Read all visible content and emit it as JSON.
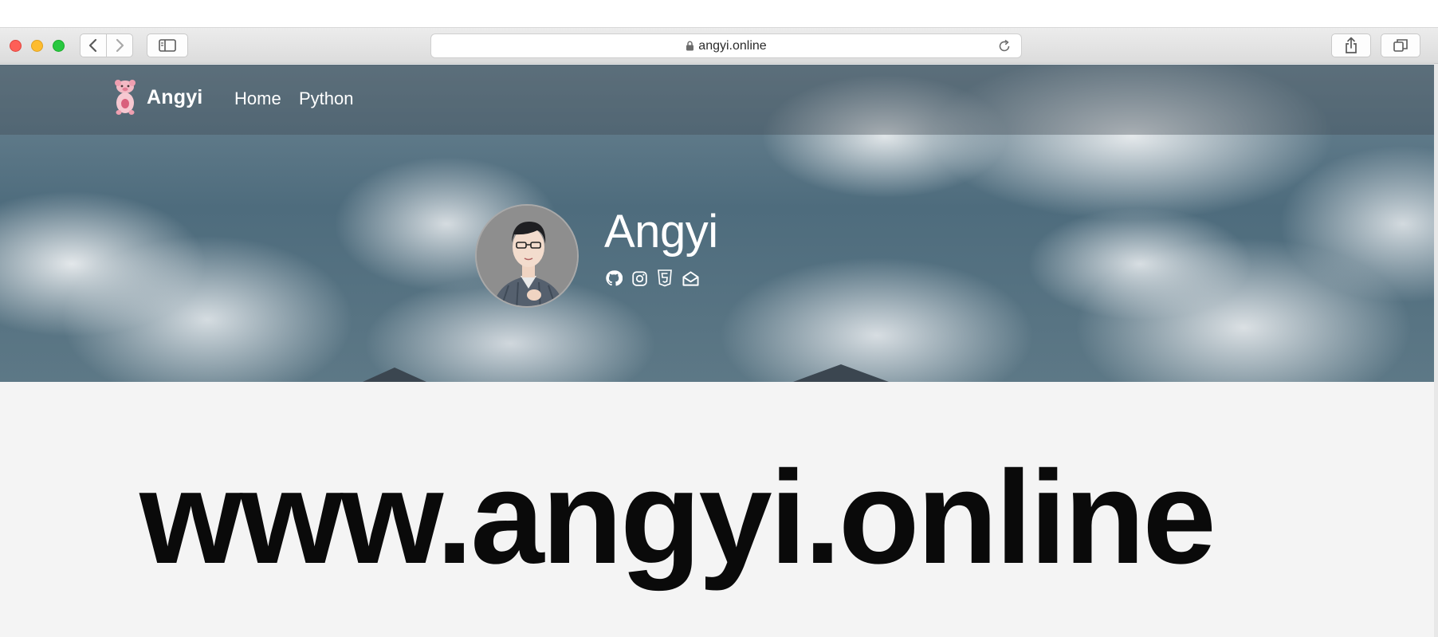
{
  "browser": {
    "url": "angyi.online",
    "icons": {
      "back": "chevron-left-icon",
      "forward": "chevron-right-icon",
      "sidebar": "sidebar-icon",
      "lock": "lock-icon",
      "reload": "reload-icon",
      "share": "share-icon",
      "tabs": "tabs-overview-icon"
    },
    "colors": {
      "close": "#fe5f57",
      "minimize": "#febc2e",
      "zoom": "#28c840"
    }
  },
  "site": {
    "brand": "Angyi",
    "nav": [
      {
        "label": "Home"
      },
      {
        "label": "Python"
      }
    ],
    "profile": {
      "name": "Angyi",
      "socials": [
        "github-icon",
        "instagram-icon",
        "html5-icon",
        "mail-icon"
      ]
    },
    "headline": "www.angyi.online"
  }
}
